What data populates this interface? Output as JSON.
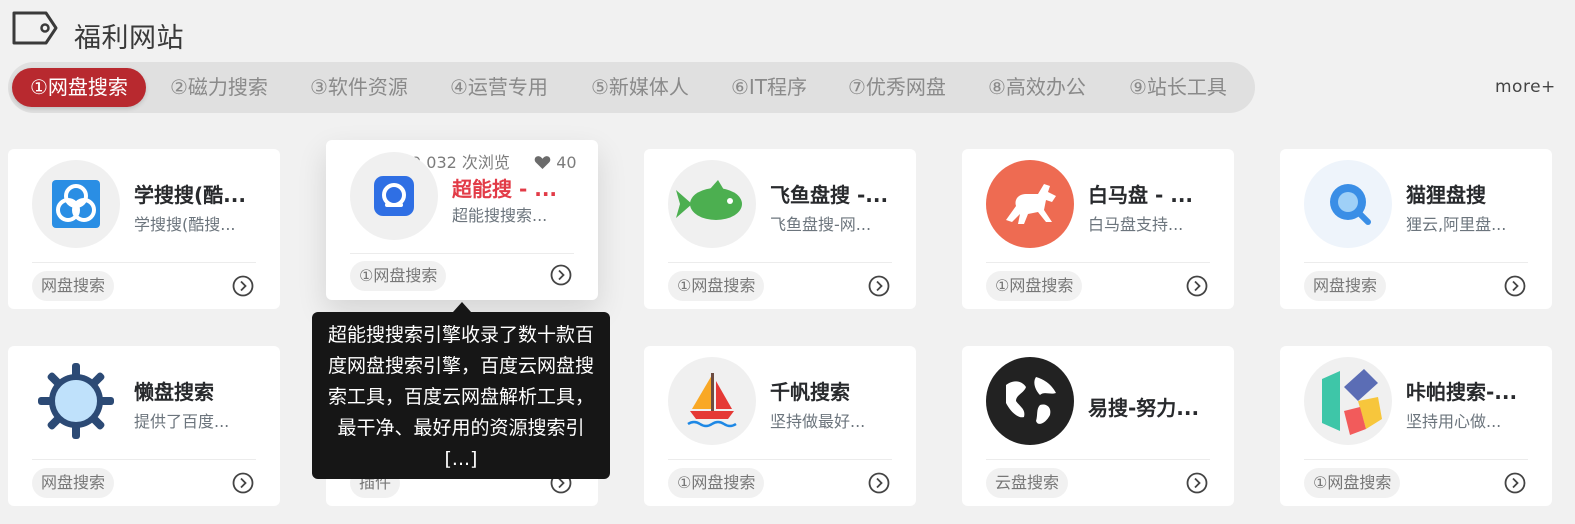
{
  "section": {
    "title": "福利网站",
    "icon": "tag-icon"
  },
  "tabs": [
    {
      "label": "①网盘搜索",
      "active": true
    },
    {
      "label": "②磁力搜索"
    },
    {
      "label": "③软件资源"
    },
    {
      "label": "④运营专用"
    },
    {
      "label": "⑤新媒体人"
    },
    {
      "label": "⑥IT程序"
    },
    {
      "label": "⑦优秀网盘"
    },
    {
      "label": "⑧高效办公"
    },
    {
      "label": "⑨站长工具"
    }
  ],
  "more_label": "more+",
  "accent_color": "#b8292f",
  "cards": [
    {
      "title": "学搜搜(酷...",
      "desc": "学搜搜(酷搜...",
      "tag": "网盘搜索",
      "icon": "cloud-logo-icon"
    },
    {
      "title": "超能搜 - ...",
      "desc": "超能搜搜索...",
      "tag": "①网盘搜索",
      "icon": "search-app-icon",
      "views": "9,032 次浏览",
      "likes": "40"
    },
    {
      "title": "飞鱼盘搜 -...",
      "desc": "飞鱼盘搜-网...",
      "tag": "①网盘搜索",
      "icon": "fish-icon"
    },
    {
      "title": "白马盘 - ...",
      "desc": "白马盘支持...",
      "tag": "①网盘搜索",
      "icon": "horse-icon"
    },
    {
      "title": "猫狸盘搜",
      "desc": "狸云,阿里盘...",
      "tag": "网盘搜索",
      "icon": "magnifier-icon"
    },
    {
      "title": "懒盘搜索",
      "desc": "提供了百度...",
      "tag": "网盘搜索",
      "icon": "gear-icon"
    },
    {
      "title": "",
      "desc": "",
      "tag": "插件",
      "icon": "plugin-icon"
    },
    {
      "title": "千帆搜索",
      "desc": "坚持做最好...",
      "tag": "①网盘搜索",
      "icon": "sailboat-icon"
    },
    {
      "title": "易搜-努力...",
      "desc": "",
      "tag": "云盘搜索",
      "icon": "globe-icon"
    },
    {
      "title": "咔帕搜索-...",
      "desc": "坚持用心做...",
      "tag": "①网盘搜索",
      "icon": "k-logo-icon"
    }
  ],
  "tooltip": {
    "text": "超能搜搜索引擎收录了数十款百度网盘搜索引擎，百度云网盘搜索工具，百度云网盘解析工具，最干净、最好用的资源搜索引[...]"
  }
}
